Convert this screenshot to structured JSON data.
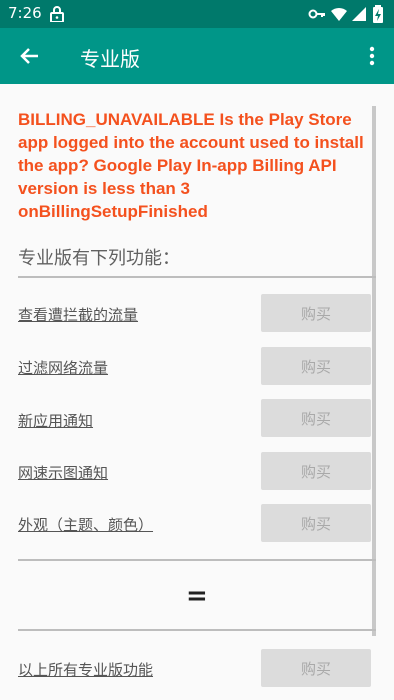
{
  "status_bar": {
    "time": "7:26",
    "icons": [
      "lock-icon",
      "key-icon",
      "wifi-icon",
      "signal-icon",
      "battery-icon"
    ]
  },
  "app_bar": {
    "title": "专业版",
    "back_icon": "arrow-back-icon",
    "more_icon": "more-vert-icon"
  },
  "error_message": "BILLING_UNAVAILABLE Is the Play Store app logged into the account used to install the app? Google Play In-app Billing API version is less than 3 onBillingSetupFinished",
  "section_title": "专业版有下列功能：",
  "features": [
    {
      "label": "查看遭拦截的流量",
      "button": "购买"
    },
    {
      "label": "过滤网络流量",
      "button": "购买"
    },
    {
      "label": "新应用通知",
      "button": "购买"
    },
    {
      "label": "网速示图通知",
      "button": "购买"
    },
    {
      "label": "外观（主题、颜色）",
      "button": "购买"
    }
  ],
  "equals_sign": "=",
  "all_features": {
    "label": "以上所有专业版功能",
    "button": "购买"
  },
  "colors": {
    "status_bar": "#00796b",
    "app_bar": "#009688",
    "error_text": "#f4511e",
    "button_bg": "#dcdcdc",
    "button_text": "#a9a9a9"
  }
}
